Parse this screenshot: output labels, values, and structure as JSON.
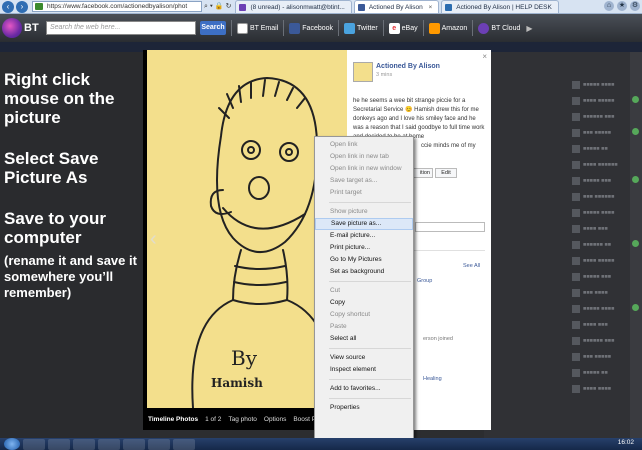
{
  "browser": {
    "address": "https://www.facebook.com/actionedbyalison/phot",
    "tabs": [
      {
        "label": "(8 unread) - alisonmwatt@btint...",
        "color": "#6c3fb5"
      },
      {
        "label": "Actioned By Alison",
        "color": "#3b5998"
      },
      {
        "label": "Actioned By Alison | HELP DESK",
        "color": "#2b6cb0"
      }
    ],
    "close_glyph": "×"
  },
  "bt_toolbar": {
    "logo_text": "BT",
    "search_placeholder": "Search the web here...",
    "search_label": "Search",
    "items": [
      {
        "label": "BT Email",
        "icon": "mail-icon",
        "color": "#ffffff"
      },
      {
        "label": "Facebook",
        "icon": "facebook-icon",
        "color": "#3b5998"
      },
      {
        "label": "Twitter",
        "icon": "twitter-icon",
        "color": "#4aa3df"
      },
      {
        "label": "eBay",
        "icon": "ebay-icon",
        "color": "#e53238"
      },
      {
        "label": "Amazon",
        "icon": "amazon-icon",
        "color": "#ff9900"
      },
      {
        "label": "BT Cloud",
        "icon": "cloud-icon",
        "color": "#6c3fb5"
      }
    ]
  },
  "instructions": [
    "Right click mouse on the picture",
    "Select Save Picture As",
    "Save to your computer",
    "(rename it and save it somewhere you’ll remember)"
  ],
  "post": {
    "page_name": "Actioned By Alison",
    "time": "3 mins",
    "text": "he he seems a wee bit strange piccie for a Secretarial Service 😊 Hamish drew this for me donkeys ago and I love his smiley face and he was a reason that I said goodbye to full time work and decided to be at home",
    "text_tail": "ccie minds me of my",
    "edit_label": "Edit",
    "option_label": "ition",
    "see_all": "See All",
    "group_label": "Group",
    "joined_label": "erson joined",
    "healing_label": "Healing"
  },
  "photo_footer": {
    "title": "Timeline Photos",
    "counter": "1 of 2",
    "items": [
      "Tag photo",
      "Options",
      "Boost Post",
      "Sh"
    ]
  },
  "photo_caption": {
    "line1": "By",
    "line2": "Hamish"
  },
  "context_menu": [
    {
      "label": "Open link",
      "disabled": true
    },
    {
      "label": "Open link in new tab",
      "disabled": true
    },
    {
      "label": "Open link in new window",
      "disabled": true
    },
    {
      "label": "Save target as...",
      "disabled": true
    },
    {
      "label": "Print target",
      "disabled": true
    },
    {
      "sep": true
    },
    {
      "label": "Show picture",
      "disabled": true
    },
    {
      "label": "Save picture as...",
      "highlight": true
    },
    {
      "label": "E-mail picture..."
    },
    {
      "label": "Print picture..."
    },
    {
      "label": "Go to My Pictures"
    },
    {
      "label": "Set as background"
    },
    {
      "sep": true
    },
    {
      "label": "Cut",
      "disabled": true
    },
    {
      "label": "Copy"
    },
    {
      "label": "Copy shortcut",
      "disabled": true
    },
    {
      "label": "Paste",
      "disabled": true
    },
    {
      "label": "Select all"
    },
    {
      "sep": true
    },
    {
      "label": "View source"
    },
    {
      "label": "Inspect element"
    },
    {
      "sep": true
    },
    {
      "label": "Add to favorites..."
    },
    {
      "sep": true
    },
    {
      "label": "Properties"
    }
  ],
  "taskbar": {
    "clock": "16:02"
  }
}
